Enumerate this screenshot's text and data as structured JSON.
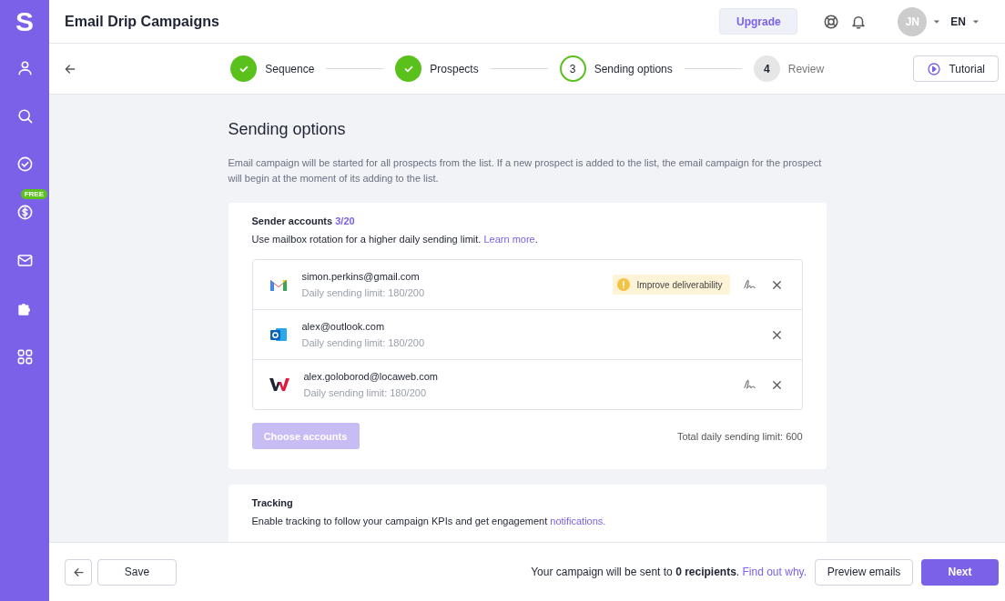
{
  "sidebar": {
    "logo": "S",
    "badge": "FREE"
  },
  "header": {
    "title": "Email Drip Campaigns",
    "upgrade": "Upgrade",
    "avatar": "JN",
    "language": "EN"
  },
  "steps": [
    {
      "label": "Sequence",
      "done": true,
      "selected": false
    },
    {
      "label": "Prospects",
      "done": true,
      "selected": false
    },
    {
      "label": "Sending options",
      "number": "3",
      "done": false,
      "selected": true
    },
    {
      "label": "Review",
      "number": "4",
      "done": false,
      "selected": false
    }
  ],
  "tutorial": "Tutorial",
  "page": {
    "title": "Sending options",
    "description": "Email campaign will be started for all prospects from the list. If a new prospect is added to the list, the email campaign for the prospect will begin at the moment of its adding to the list."
  },
  "sender_accounts": {
    "title": "Sender accounts",
    "count": "3/20",
    "hint": "Use mailbox rotation for a higher daily sending limit.",
    "link": "Learn more",
    "after": ".",
    "accounts": [
      {
        "kind": "gmail",
        "email": "simon.perkins@gmail.com",
        "limit": "Daily sending limit: 180/200",
        "warning": "Improve deliverability",
        "signature": true
      },
      {
        "kind": "outlook",
        "email": "alex@outlook.com",
        "limit": "Daily sending limit: 180/200",
        "signature": false
      },
      {
        "kind": "locaweb",
        "email": "alex.goloborod@locaweb.com",
        "limit": "Daily sending limit: 180/200",
        "signature": true
      }
    ],
    "choose_button": {
      "label": "Choose accounts",
      "disabled": true
    },
    "total": "Total daily sending limit: 600"
  },
  "tracking": {
    "title": "Tracking",
    "text": "Enable tracking to follow your campaign KPIs and get engagement",
    "link": "notifications."
  },
  "footer": {
    "save": "Save",
    "summary": "Your campaign will be sent to **0 recipients**.",
    "link": "Find out why.",
    "preview": "Preview emails",
    "next": "Next"
  }
}
